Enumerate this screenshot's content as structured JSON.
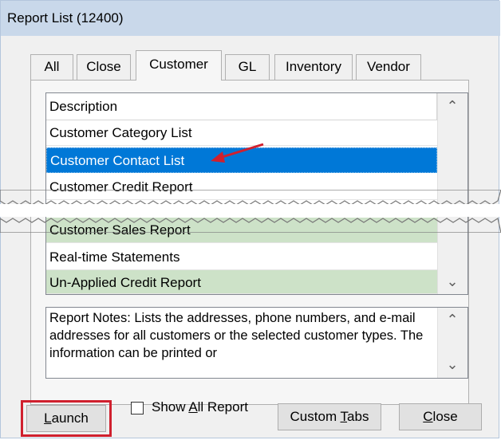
{
  "window": {
    "title": "Report List (12400)"
  },
  "tabs": [
    {
      "label": "All"
    },
    {
      "label": "Close"
    },
    {
      "label": "Customer"
    },
    {
      "label": "GL"
    },
    {
      "label": "Inventory"
    },
    {
      "label": "Vendor"
    }
  ],
  "active_tab": "Customer",
  "list": {
    "header": "Description",
    "rows_top": [
      {
        "label": "Customer Category List"
      },
      {
        "label": "Customer Contact List"
      },
      {
        "label": "Customer Credit Report"
      }
    ],
    "rows_bottom": [
      {
        "label": "Customer Sales Report"
      },
      {
        "label": "Real-time Statements"
      },
      {
        "label": "Un-Applied Credit Report"
      }
    ],
    "selected": "Customer Contact List"
  },
  "notes": {
    "text": "Report Notes:  Lists the addresses, phone numbers, and e-mail addresses for all customers or the selected customer types. The information can be printed or"
  },
  "buttons": {
    "launch": {
      "pre": "",
      "key": "L",
      "post": "aunch"
    },
    "custom_tabs": {
      "pre": "Custom ",
      "key": "T",
      "post": "abs"
    },
    "close": {
      "pre": "",
      "key": "C",
      "post": "lose"
    }
  },
  "checkbox": {
    "pre": "Show ",
    "key": "A",
    "post": "ll Report",
    "checked": false
  },
  "colors": {
    "selection": "#0078d7",
    "highlight_green": "#cde2c8",
    "annotation_red": "#d0202e",
    "titlebar": "#c9d8ea"
  }
}
